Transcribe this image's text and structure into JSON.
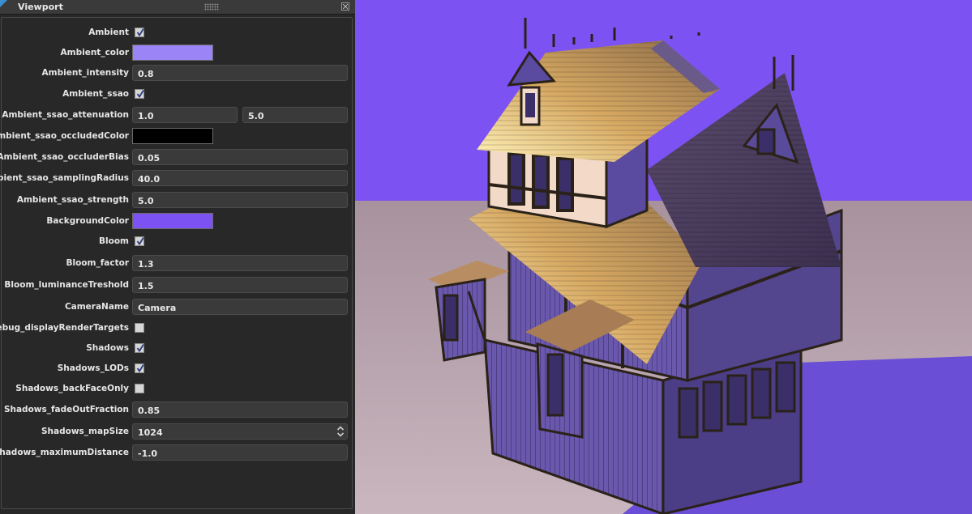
{
  "panel": {
    "title": "Viewport",
    "properties": [
      {
        "label": "Ambient",
        "type": "checkbox",
        "checked": true
      },
      {
        "label": "Ambient_color",
        "type": "color",
        "color": "#9b84f5"
      },
      {
        "label": "Ambient_intensity",
        "type": "number",
        "value": "0.8"
      },
      {
        "label": "Ambient_ssao",
        "type": "checkbox",
        "checked": true
      },
      {
        "label": "Ambient_ssao_attenuation",
        "type": "pair",
        "value": "1.0",
        "value2": "5.0"
      },
      {
        "label": "Ambient_ssao_occludedColor",
        "type": "color",
        "color": "#000000"
      },
      {
        "label": "Ambient_ssao_occluderBias",
        "type": "number",
        "value": "0.05"
      },
      {
        "label": "Ambient_ssao_samplingRadius",
        "type": "number",
        "value": "40.0"
      },
      {
        "label": "Ambient_ssao_strength",
        "type": "number",
        "value": "5.0"
      },
      {
        "label": "BackgroundColor",
        "type": "color",
        "color": "#7c52f2"
      },
      {
        "label": "Bloom",
        "type": "checkbox",
        "checked": true
      },
      {
        "label": "Bloom_factor",
        "type": "number",
        "value": "1.3"
      },
      {
        "label": "Bloom_luminanceTreshold",
        "type": "number",
        "value": "1.5"
      },
      {
        "label": "CameraName",
        "type": "text",
        "value": "Camera"
      },
      {
        "label": "Debug_displayRenderTargets",
        "type": "checkbox",
        "checked": false
      },
      {
        "label": "Shadows",
        "type": "checkbox",
        "checked": true
      },
      {
        "label": "Shadows_LODs",
        "type": "checkbox",
        "checked": true
      },
      {
        "label": "Shadows_backFaceOnly",
        "type": "checkbox",
        "checked": false
      },
      {
        "label": "Shadows_fadeOutFraction",
        "type": "number",
        "value": "0.85"
      },
      {
        "label": "Shadows_mapSize",
        "type": "select",
        "value": "1024"
      },
      {
        "label": "Shadows_maximumDistance",
        "type": "number",
        "value": "-1.0"
      }
    ]
  },
  "viewport": {
    "sky_color": "#7c52f2",
    "ground_color": "#b8a3ad",
    "shadow_color": "#6a4fd6",
    "subject": "timber-frame house model"
  }
}
